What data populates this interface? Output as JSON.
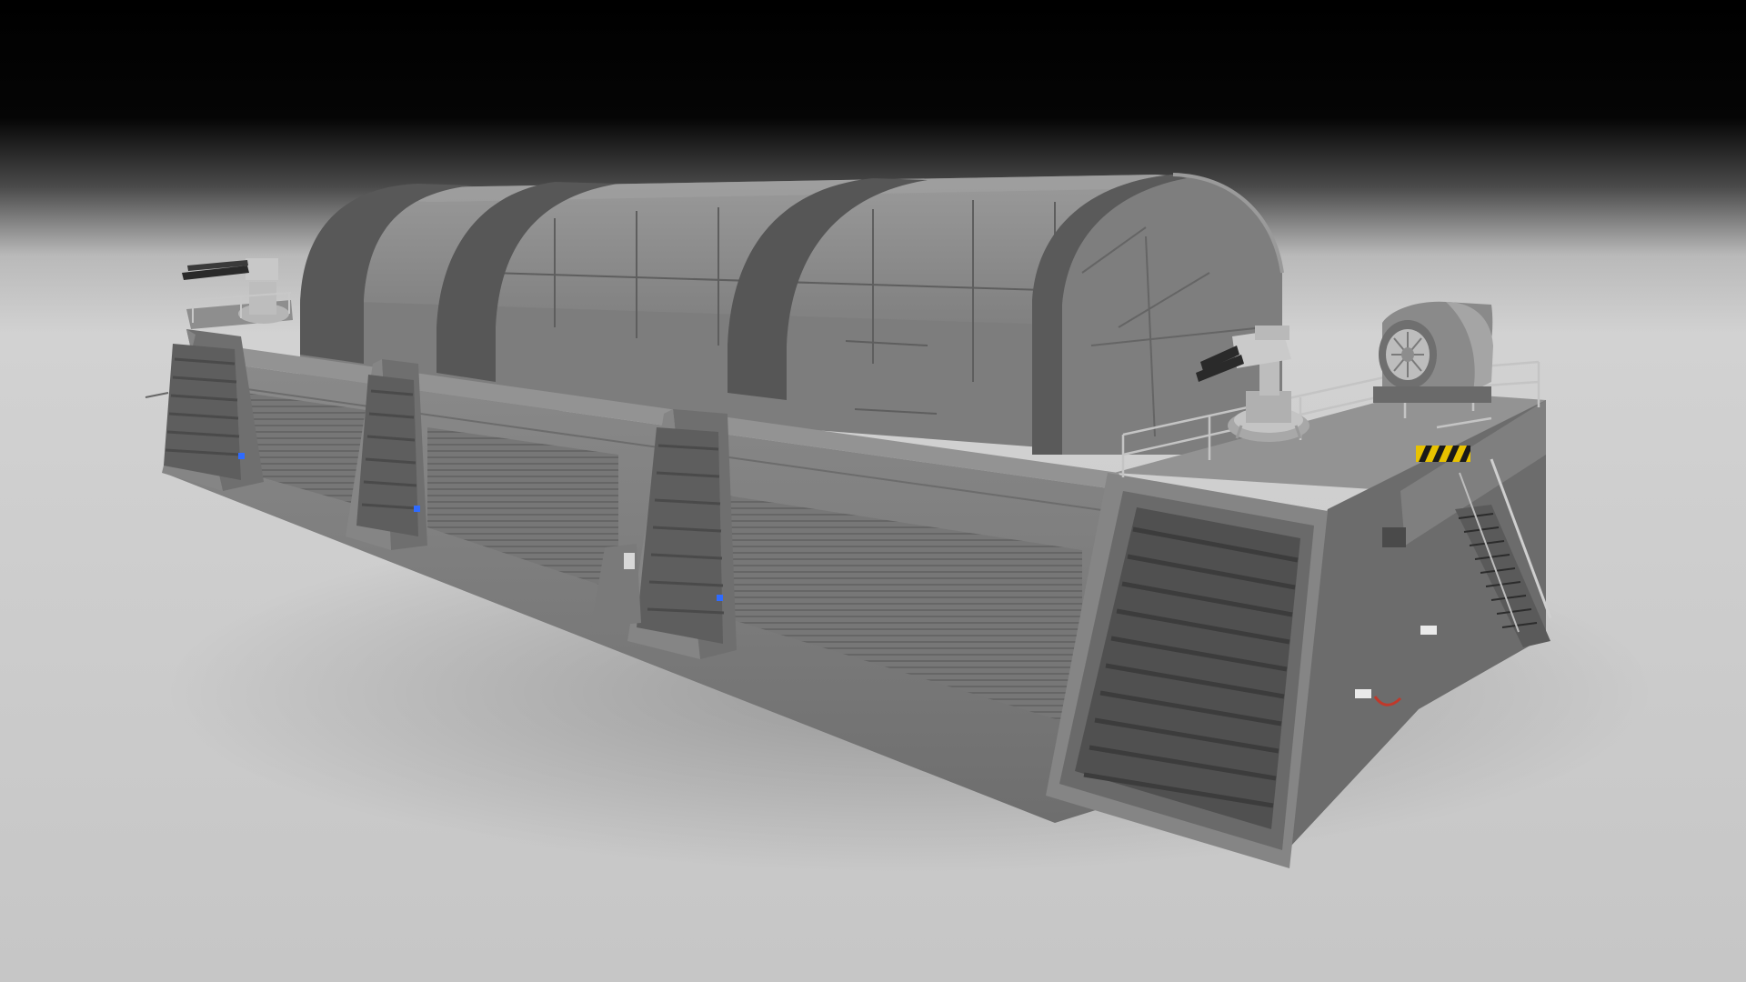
{
  "scene": {
    "subject": "hangar-bunker-3d-render",
    "parts": [
      "arched-roof-segments",
      "concrete-base",
      "shutter-doors",
      "buttress-pillars",
      "twin-gun-turret-left",
      "twin-gun-turret-right",
      "generator-unit",
      "stairs",
      "hazard-stripe-sign",
      "blue-indicator-lights"
    ]
  },
  "colors": {
    "sky_top": "#000000",
    "ground": "#c9c9c9",
    "ground_far": "#d6d6d6",
    "wall_front": "#7a7a7a",
    "wall_dark": "#6a6a6a",
    "roof_light": "#8c8c8c",
    "roof_mid": "#7d7d7d",
    "roof_dark": "#5c5c5c",
    "rib": "#555555",
    "shutter": "#757575",
    "panel_slat": "#5a5a5a",
    "indicator_blue": "#2f6bff",
    "hazard_yellow": "#e8c200",
    "hazard_black": "#1a1a1a",
    "red_cable": "#c0392b"
  }
}
